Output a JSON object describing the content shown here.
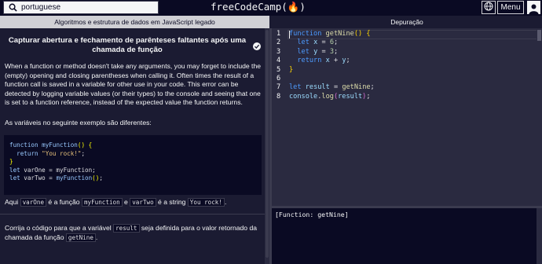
{
  "navbar": {
    "search_value": "portuguese",
    "brand": "freeCodeCamp(🔥)",
    "menu_label": "Menu"
  },
  "tabs": {
    "left": "Algoritmos e estrutura de dados em JavaScript legado",
    "right": "Depuração"
  },
  "instructions": {
    "title": "Capturar abertura e fechamento de parênteses faltantes após uma chamada de função",
    "paragraph1": "When a function or method doesn't take any arguments, you may forget to include the (empty) opening and closing parentheses when calling it. Often times the result of a function call is saved in a variable for other use in your code. This error can be detected by logging variable values (or their types) to the console and seeing that one is set to a function reference, instead of the expected value the function returns.",
    "paragraph2": "As variáveis no seguinte exemplo são diferentes:",
    "example_code": [
      "function myFunction() {",
      "  return \"You rock!\";",
      "}",
      "let varOne = myFunction;",
      "let varTwo = myFunction();"
    ],
    "p3": {
      "t1": "Aqui ",
      "c1": "varOne",
      "t2": " é a função ",
      "c2": "myFunction",
      "t3": " e ",
      "c3": "varTwo",
      "t4": " é a string ",
      "c4": "You rock!",
      "t5": "."
    },
    "p4": {
      "t1": "Corrija o código para que a variável ",
      "c1": "result",
      "t2": " seja definida para o valor retornado da chamada da função ",
      "c2": "getNine",
      "t3": "."
    }
  },
  "editor": {
    "line_numbers": [
      "1",
      "2",
      "3",
      "4",
      "5",
      "6",
      "7",
      "8"
    ],
    "lines": [
      "function getNine() {",
      "  let x = 6;",
      "  let y = 3;",
      "  return x + y;",
      "}",
      "",
      "let result = getNine;",
      "console.log(result);"
    ]
  },
  "console": {
    "output": "[Function: getNine]"
  },
  "colors": {
    "bg_dark": "#0a0a23",
    "panel": "#1b1b32",
    "editor_bg": "#2a2a40",
    "tab_active": "#d0d0d5",
    "keyword": "#4d9bff"
  },
  "icons": {
    "search": "search-icon",
    "globe": "globe-icon",
    "avatar": "user-avatar-icon",
    "check": "check-circle-icon"
  }
}
